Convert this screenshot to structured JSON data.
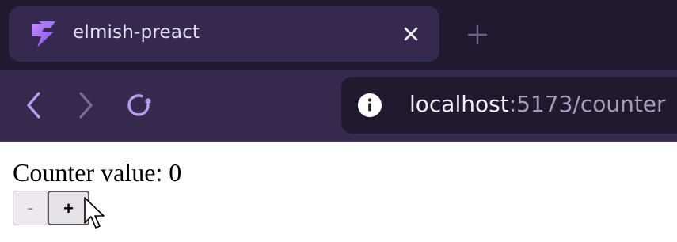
{
  "browser": {
    "tab": {
      "title": "elmish-preact",
      "favicon": "vite-bolt-icon",
      "close_icon": "close-icon"
    },
    "new_tab_icon": "plus-icon",
    "toolbar": {
      "back_icon": "chevron-left-icon",
      "forward_icon": "chevron-right-icon",
      "reload_icon": "reload-icon"
    },
    "address_bar": {
      "site_info_icon": "info-icon",
      "host": "localhost",
      "rest": ":5173/counter"
    },
    "colors": {
      "tabstrip": "#201a30",
      "active_tab": "#36294f",
      "toolbar": "#35294d",
      "accent": "#b89cf0"
    }
  },
  "page": {
    "counter_label": "Counter value: 0",
    "decrement_label": "-",
    "increment_label": "+"
  }
}
